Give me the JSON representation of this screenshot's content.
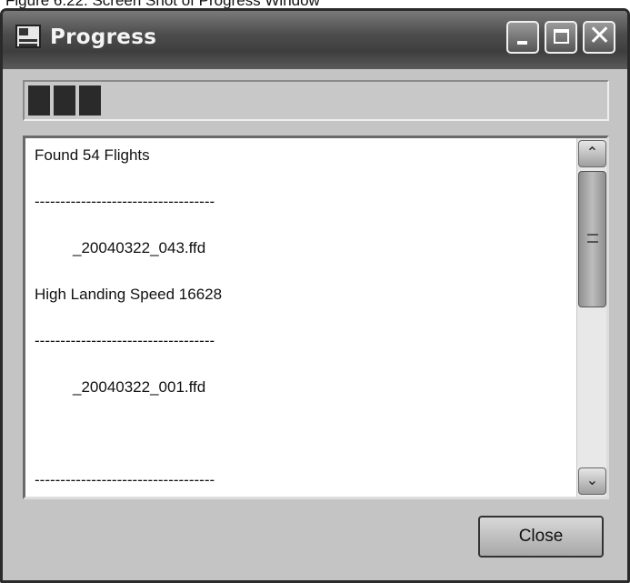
{
  "caption": {
    "text": "Figure 6.22. Screen Shot of Progress Window"
  },
  "window": {
    "title": "Progress",
    "controls": {
      "minimize": "minimize",
      "maximize": "maximize",
      "close": "close"
    }
  },
  "progress": {
    "filled_blocks": 3
  },
  "log": {
    "lines": [
      "Found 54 Flights",
      "-----------------------------------",
      "_20040322_043.ffd",
      "High Landing Speed 16628",
      "-----------------------------------",
      "_20040322_001.ffd",
      "",
      "-----------------------------------"
    ]
  },
  "footer": {
    "close_label": "Close"
  },
  "icons": {
    "app": "window-app-icon",
    "scroll_up": "chevron-up-icon",
    "scroll_down": "chevron-down-icon"
  }
}
